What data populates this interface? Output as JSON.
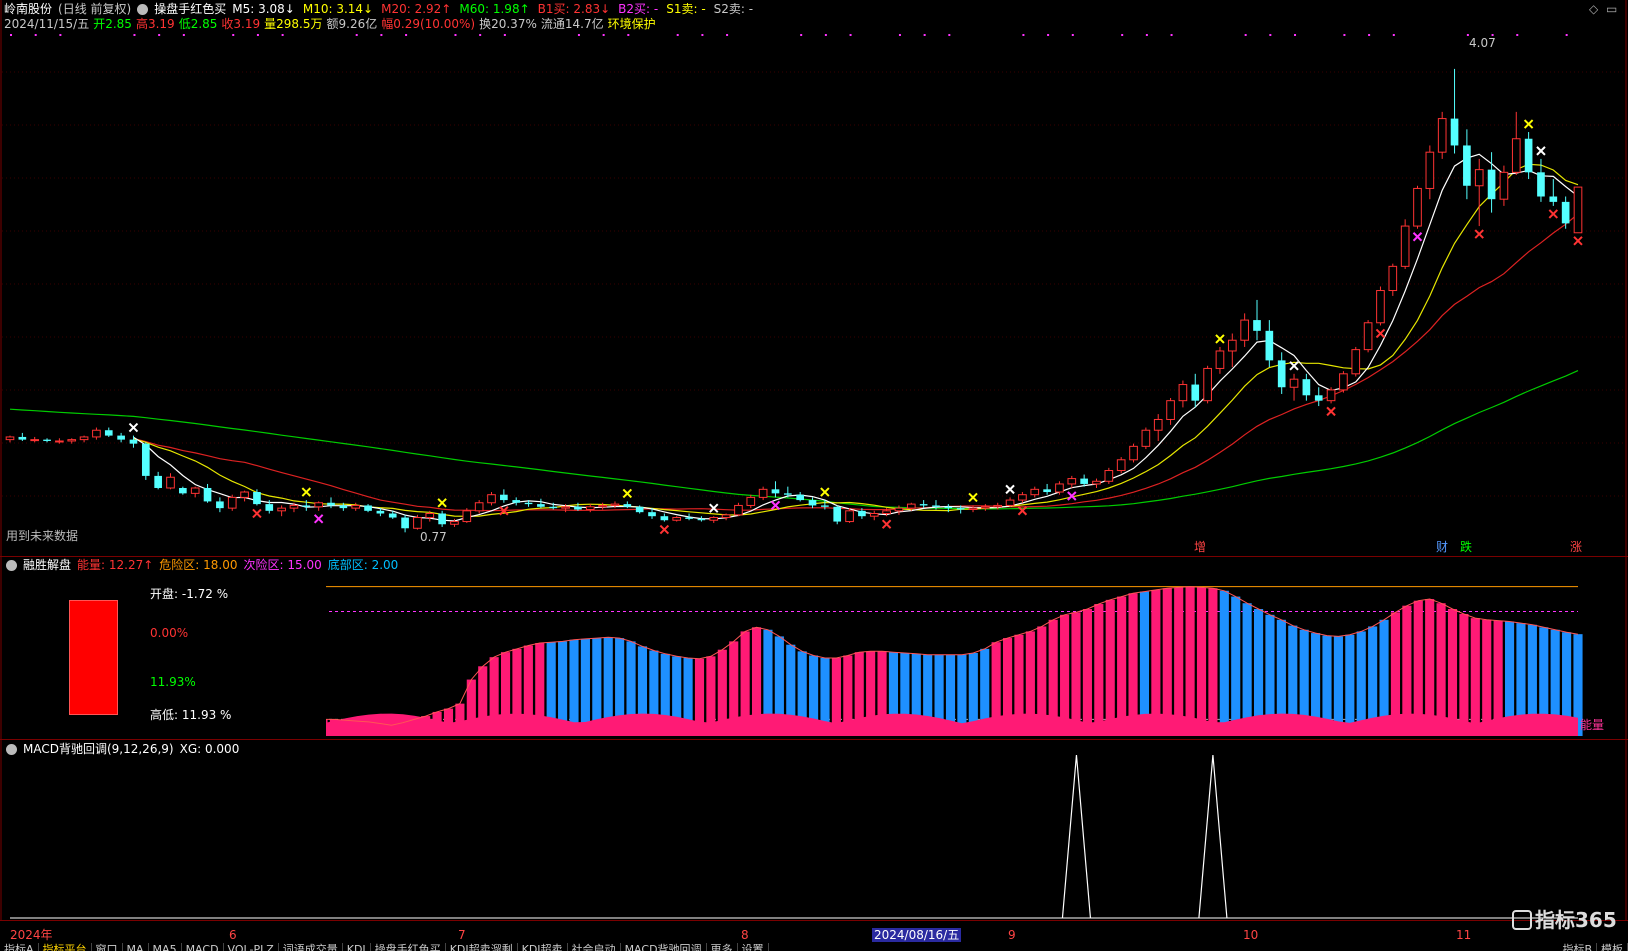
{
  "header": {
    "stock": "岭南股份",
    "period": "(日线 前复权)",
    "indicator": "操盘手红色买",
    "ma": [
      {
        "label": "M5: 3.08",
        "arrow": "↓",
        "color": "#ffffff"
      },
      {
        "label": "M10: 3.14",
        "arrow": "↓",
        "color": "#ffff00"
      },
      {
        "label": "M20: 2.92",
        "arrow": "↑",
        "color": "#ff3333"
      },
      {
        "label": "M60: 1.98",
        "arrow": "↑",
        "color": "#00ff00"
      },
      {
        "label": "B1买: 2.83",
        "arrow": "↓",
        "color": "#ff3333"
      },
      {
        "label": "B2买: -",
        "arrow": "",
        "color": "#ff33ff"
      },
      {
        "label": "S1卖: -",
        "arrow": "",
        "color": "#ffff00"
      },
      {
        "label": "S2卖: -",
        "arrow": "",
        "color": "#c8c8c8"
      }
    ],
    "quote": [
      {
        "text": "2024/11/15/五",
        "color": "#c8c8c8"
      },
      {
        "text": "开2.85",
        "color": "#00ff00"
      },
      {
        "text": "高3.19",
        "color": "#ff3333"
      },
      {
        "text": "低2.85",
        "color": "#00ff00"
      },
      {
        "text": "收3.19",
        "color": "#ff3333"
      },
      {
        "text": "量298.5万",
        "color": "#ffff00"
      },
      {
        "text": "额9.26亿",
        "color": "#c8c8c8"
      },
      {
        "text": "幅0.29(10.00%)",
        "color": "#ff3333"
      },
      {
        "text": "换20.37%",
        "color": "#c8c8c8"
      },
      {
        "text": "流通14.7亿",
        "color": "#c8c8c8"
      },
      {
        "text": "环境保护",
        "color": "#ffff00"
      }
    ]
  },
  "main_chart": {
    "high_label": "4.07",
    "low_label": "0.77",
    "future_note": "用到未来数据",
    "markers": [
      {
        "text": "增",
        "color": "#ff4444"
      },
      {
        "text": "财",
        "color": "#5599ff"
      },
      {
        "text": "跌",
        "color": "#00ff00"
      },
      {
        "text": "涨",
        "color": "#ff4444"
      }
    ]
  },
  "panel2": {
    "title": "融胜解盘",
    "legend": [
      {
        "text": "能量: 12.27",
        "arrow": "↑",
        "color": "#ff3333"
      },
      {
        "text": "危险区: 18.00",
        "arrow": "",
        "color": "#ff9900"
      },
      {
        "text": "次险区: 15.00",
        "arrow": "",
        "color": "#ff33ff"
      },
      {
        "text": "底部区: 2.00",
        "arrow": "",
        "color": "#00bfff"
      }
    ],
    "box": {
      "open_label": "开盘:  -1.72 %",
      "upper_pct": "0.00%",
      "lower_pct": "11.93%",
      "range_label": "高低:  11.93 %"
    },
    "end_label": "能量"
  },
  "panel3": {
    "title": "MACD背驰回调(9,12,26,9)",
    "xg": "XG: 0.000"
  },
  "x_axis": {
    "labels": [
      "2024年",
      "6",
      "7",
      "8",
      "2024/08/16/五",
      "9",
      "10",
      "11"
    ]
  },
  "watermark": "指标365",
  "tabs": [
    "指标A",
    "指标平台",
    "窗口",
    "MA",
    "MA5",
    "MACD",
    "VOL-PLZ",
    "词语成交量",
    "KDJ",
    "操盘手红色买",
    "KDJ超卖溜剩",
    "KDJ超卖",
    "社会启动",
    "MACD背驰回调",
    "更多",
    "设置"
  ],
  "right_tabs": [
    "指标B",
    "模板"
  ],
  "chart_data": [
    {
      "type": "candlestick",
      "title": "操盘手红色买",
      "ylim": [
        0.6,
        4.3
      ],
      "ohlc": [
        [
          1.31,
          1.34,
          1.29,
          1.33
        ],
        [
          1.33,
          1.36,
          1.3,
          1.31
        ],
        [
          1.31,
          1.33,
          1.29,
          1.31
        ],
        [
          1.31,
          1.32,
          1.29,
          1.3
        ],
        [
          1.3,
          1.32,
          1.28,
          1.3
        ],
        [
          1.3,
          1.32,
          1.28,
          1.31
        ],
        [
          1.31,
          1.34,
          1.29,
          1.33
        ],
        [
          1.33,
          1.4,
          1.31,
          1.38
        ],
        [
          1.38,
          1.4,
          1.33,
          1.34
        ],
        [
          1.34,
          1.36,
          1.29,
          1.31
        ],
        [
          1.31,
          1.34,
          1.25,
          1.28
        ],
        [
          1.28,
          1.29,
          1.01,
          1.04
        ],
        [
          1.04,
          1.07,
          0.94,
          0.95
        ],
        [
          0.95,
          1.06,
          0.94,
          1.03
        ],
        [
          0.95,
          0.96,
          0.9,
          0.91
        ],
        [
          0.91,
          0.96,
          0.88,
          0.95
        ],
        [
          0.95,
          0.98,
          0.84,
          0.85
        ],
        [
          0.85,
          0.88,
          0.77,
          0.8
        ],
        [
          0.8,
          0.9,
          0.78,
          0.88
        ],
        [
          0.88,
          0.93,
          0.85,
          0.92
        ],
        [
          0.92,
          0.94,
          0.82,
          0.83
        ],
        [
          0.83,
          0.86,
          0.76,
          0.78
        ],
        [
          0.78,
          0.82,
          0.74,
          0.8
        ],
        [
          0.8,
          0.84,
          0.77,
          0.82
        ],
        [
          0.82,
          0.86,
          0.78,
          0.81
        ],
        [
          0.81,
          0.85,
          0.78,
          0.84
        ],
        [
          0.84,
          0.88,
          0.8,
          0.82
        ],
        [
          0.82,
          0.84,
          0.78,
          0.8
        ],
        [
          0.8,
          0.84,
          0.78,
          0.82
        ],
        [
          0.82,
          0.83,
          0.77,
          0.78
        ],
        [
          0.78,
          0.8,
          0.74,
          0.76
        ],
        [
          0.76,
          0.78,
          0.72,
          0.73
        ],
        [
          0.73,
          0.75,
          0.62,
          0.65
        ],
        [
          0.65,
          0.75,
          0.64,
          0.73
        ],
        [
          0.73,
          0.78,
          0.7,
          0.76
        ],
        [
          0.76,
          0.78,
          0.66,
          0.68
        ],
        [
          0.68,
          0.72,
          0.66,
          0.7
        ],
        [
          0.7,
          0.8,
          0.69,
          0.78
        ],
        [
          0.78,
          0.86,
          0.76,
          0.84
        ],
        [
          0.84,
          0.92,
          0.82,
          0.9
        ],
        [
          0.9,
          0.94,
          0.84,
          0.86
        ],
        [
          0.86,
          0.88,
          0.82,
          0.84
        ],
        [
          0.84,
          0.86,
          0.81,
          0.83
        ],
        [
          0.83,
          0.87,
          0.8,
          0.81
        ],
        [
          0.81,
          0.84,
          0.79,
          0.8
        ],
        [
          0.8,
          0.83,
          0.77,
          0.81
        ],
        [
          0.81,
          0.84,
          0.78,
          0.79
        ],
        [
          0.79,
          0.83,
          0.77,
          0.81
        ],
        [
          0.81,
          0.84,
          0.79,
          0.82
        ],
        [
          0.82,
          0.85,
          0.8,
          0.83
        ],
        [
          0.83,
          0.85,
          0.8,
          0.81
        ],
        [
          0.81,
          0.82,
          0.76,
          0.77
        ],
        [
          0.77,
          0.8,
          0.72,
          0.74
        ],
        [
          0.74,
          0.76,
          0.7,
          0.71
        ],
        [
          0.71,
          0.74,
          0.7,
          0.73
        ],
        [
          0.73,
          0.76,
          0.71,
          0.72
        ],
        [
          0.72,
          0.74,
          0.7,
          0.71
        ],
        [
          0.71,
          0.74,
          0.69,
          0.73
        ],
        [
          0.73,
          0.76,
          0.71,
          0.75
        ],
        [
          0.75,
          0.84,
          0.74,
          0.82
        ],
        [
          0.82,
          0.9,
          0.8,
          0.88
        ],
        [
          0.88,
          0.96,
          0.86,
          0.94
        ],
        [
          0.94,
          1.0,
          0.88,
          0.91
        ],
        [
          0.91,
          0.96,
          0.88,
          0.9
        ],
        [
          0.9,
          0.92,
          0.85,
          0.86
        ],
        [
          0.86,
          0.88,
          0.8,
          0.82
        ],
        [
          0.82,
          0.86,
          0.79,
          0.81
        ],
        [
          0.81,
          0.82,
          0.68,
          0.7
        ],
        [
          0.7,
          0.8,
          0.69,
          0.78
        ],
        [
          0.78,
          0.8,
          0.72,
          0.74
        ],
        [
          0.74,
          0.78,
          0.71,
          0.76
        ],
        [
          0.76,
          0.8,
          0.74,
          0.78
        ],
        [
          0.78,
          0.82,
          0.75,
          0.8
        ],
        [
          0.8,
          0.84,
          0.78,
          0.83
        ],
        [
          0.83,
          0.86,
          0.8,
          0.82
        ],
        [
          0.82,
          0.86,
          0.79,
          0.81
        ],
        [
          0.81,
          0.83,
          0.77,
          0.8
        ],
        [
          0.8,
          0.82,
          0.76,
          0.79
        ],
        [
          0.79,
          0.82,
          0.77,
          0.8
        ],
        [
          0.8,
          0.83,
          0.78,
          0.81
        ],
        [
          0.81,
          0.84,
          0.79,
          0.82
        ],
        [
          0.82,
          0.88,
          0.81,
          0.86
        ],
        [
          0.86,
          0.92,
          0.84,
          0.9
        ],
        [
          0.9,
          0.96,
          0.88,
          0.94
        ],
        [
          0.94,
          0.98,
          0.9,
          0.92
        ],
        [
          0.92,
          1.0,
          0.9,
          0.98
        ],
        [
          0.98,
          1.04,
          0.95,
          1.02
        ],
        [
          1.02,
          1.05,
          0.96,
          0.98
        ],
        [
          0.98,
          1.02,
          0.95,
          1.0
        ],
        [
          1.0,
          1.1,
          0.98,
          1.08
        ],
        [
          1.08,
          1.18,
          1.06,
          1.16
        ],
        [
          1.16,
          1.28,
          1.14,
          1.26
        ],
        [
          1.26,
          1.4,
          1.24,
          1.38
        ],
        [
          1.38,
          1.5,
          1.3,
          1.46
        ],
        [
          1.46,
          1.62,
          1.42,
          1.6
        ],
        [
          1.6,
          1.75,
          1.55,
          1.72
        ],
        [
          1.72,
          1.8,
          1.55,
          1.6
        ],
        [
          1.6,
          1.86,
          1.58,
          1.84
        ],
        [
          1.84,
          2.0,
          1.8,
          1.97
        ],
        [
          1.97,
          2.1,
          1.85,
          2.05
        ],
        [
          2.05,
          2.25,
          2.0,
          2.2
        ],
        [
          2.2,
          2.35,
          2.05,
          2.12
        ],
        [
          2.12,
          2.2,
          1.85,
          1.9
        ],
        [
          1.9,
          1.96,
          1.65,
          1.7
        ],
        [
          1.7,
          1.8,
          1.6,
          1.76
        ],
        [
          1.76,
          1.8,
          1.6,
          1.64
        ],
        [
          1.64,
          1.7,
          1.56,
          1.6
        ],
        [
          1.6,
          1.7,
          1.58,
          1.68
        ],
        [
          1.68,
          1.82,
          1.66,
          1.8
        ],
        [
          1.8,
          2.0,
          1.78,
          1.98
        ],
        [
          1.98,
          2.2,
          1.96,
          2.18
        ],
        [
          2.18,
          2.45,
          2.16,
          2.42
        ],
        [
          2.42,
          2.62,
          2.38,
          2.6
        ],
        [
          2.6,
          2.95,
          2.58,
          2.9
        ],
        [
          2.9,
          3.2,
          2.88,
          3.18
        ],
        [
          3.18,
          3.5,
          3.1,
          3.45
        ],
        [
          3.45,
          3.75,
          3.4,
          3.7
        ],
        [
          3.7,
          4.07,
          3.44,
          3.5
        ],
        [
          3.5,
          3.62,
          3.1,
          3.2
        ],
        [
          3.2,
          3.4,
          2.9,
          3.32
        ],
        [
          3.32,
          3.45,
          3.0,
          3.1
        ],
        [
          3.1,
          3.35,
          3.05,
          3.3
        ],
        [
          3.3,
          3.75,
          3.28,
          3.55
        ],
        [
          3.55,
          3.6,
          3.25,
          3.3
        ],
        [
          3.3,
          3.4,
          3.08,
          3.12
        ],
        [
          3.12,
          3.25,
          3.05,
          3.08
        ],
        [
          3.08,
          3.12,
          2.88,
          2.92
        ],
        [
          2.85,
          3.19,
          2.85,
          3.19
        ]
      ],
      "series": [
        {
          "name": "M5",
          "color": "#ffffff"
        },
        {
          "name": "M10",
          "color": "#ffff00"
        },
        {
          "name": "M20",
          "color": "#ff3333"
        },
        {
          "name": "M60",
          "color": "#00ff00"
        }
      ]
    },
    {
      "type": "bar",
      "title": "融胜解盘",
      "ylim": [
        0,
        20
      ],
      "reference_lines": [
        {
          "name": "危险区",
          "value": 18
        },
        {
          "name": "次险区",
          "value": 15
        },
        {
          "name": "底部区",
          "value": 2
        }
      ],
      "values": [
        2.0,
        2.0,
        1.9,
        1.8,
        1.7,
        1.5,
        1.3,
        1.6,
        2.0,
        2.4,
        2.9,
        3.3,
        3.9,
        6.8,
        8.4,
        9.5,
        10.1,
        10.5,
        10.9,
        11.2,
        11.3,
        11.4,
        11.6,
        11.7,
        11.8,
        11.9,
        11.8,
        11.4,
        10.8,
        10.3,
        9.9,
        9.6,
        9.4,
        9.3,
        9.6,
        10.4,
        11.4,
        12.6,
        13.1,
        12.8,
        12.0,
        11.0,
        10.2,
        9.7,
        9.4,
        9.4,
        9.7,
        10.1,
        10.2,
        10.2,
        10.1,
        10.0,
        9.9,
        9.8,
        9.8,
        9.8,
        9.8,
        10.0,
        10.5,
        11.3,
        11.8,
        12.2,
        12.6,
        13.2,
        14.0,
        14.6,
        14.9,
        15.3,
        15.9,
        16.4,
        16.8,
        17.2,
        17.4,
        17.6,
        17.8,
        17.9,
        18.0,
        17.9,
        17.8,
        17.5,
        16.8,
        16.0,
        15.3,
        14.6,
        14.0,
        13.3,
        12.8,
        12.4,
        12.1,
        12.0,
        12.2,
        12.6,
        13.2,
        14.0,
        14.9,
        15.7,
        16.3,
        16.5,
        16.0,
        15.3,
        14.7,
        14.2,
        14.0,
        13.9,
        13.8,
        13.6,
        13.4,
        13.1,
        12.8,
        12.5,
        12.27
      ],
      "colors": [
        "r",
        "r",
        "b",
        "b",
        "b",
        "b",
        "b",
        "r",
        "r",
        "r",
        "r",
        "r",
        "r",
        "r",
        "r",
        "r",
        "r",
        "r",
        "r",
        "r",
        "b",
        "b",
        "b",
        "b",
        "b",
        "b",
        "b",
        "b",
        "b",
        "b",
        "b",
        "b",
        "b",
        "r",
        "r",
        "r",
        "r",
        "r",
        "r",
        "b",
        "b",
        "b",
        "b",
        "b",
        "b",
        "r",
        "r",
        "r",
        "r",
        "r",
        "b",
        "b",
        "b",
        "b",
        "b",
        "b",
        "b",
        "b",
        "b",
        "r",
        "r",
        "r",
        "r",
        "r",
        "r",
        "r",
        "r",
        "r",
        "r",
        "r",
        "r",
        "r",
        "b",
        "r",
        "r",
        "r",
        "r",
        "r",
        "r",
        "b",
        "b",
        "b",
        "b",
        "b",
        "b",
        "b",
        "b",
        "b",
        "b",
        "b",
        "b",
        "b",
        "b",
        "b",
        "r",
        "r",
        "r",
        "r",
        "r",
        "r",
        "r",
        "r",
        "r",
        "r",
        "b",
        "b",
        "b",
        "b",
        "b",
        "b",
        "b",
        "b",
        "r"
      ]
    },
    {
      "type": "line",
      "title": "MACD背驰回调",
      "ylim": [
        0,
        1
      ],
      "spikes_at": [
        85,
        95
      ],
      "values_note": "XG signal 0/1"
    }
  ]
}
